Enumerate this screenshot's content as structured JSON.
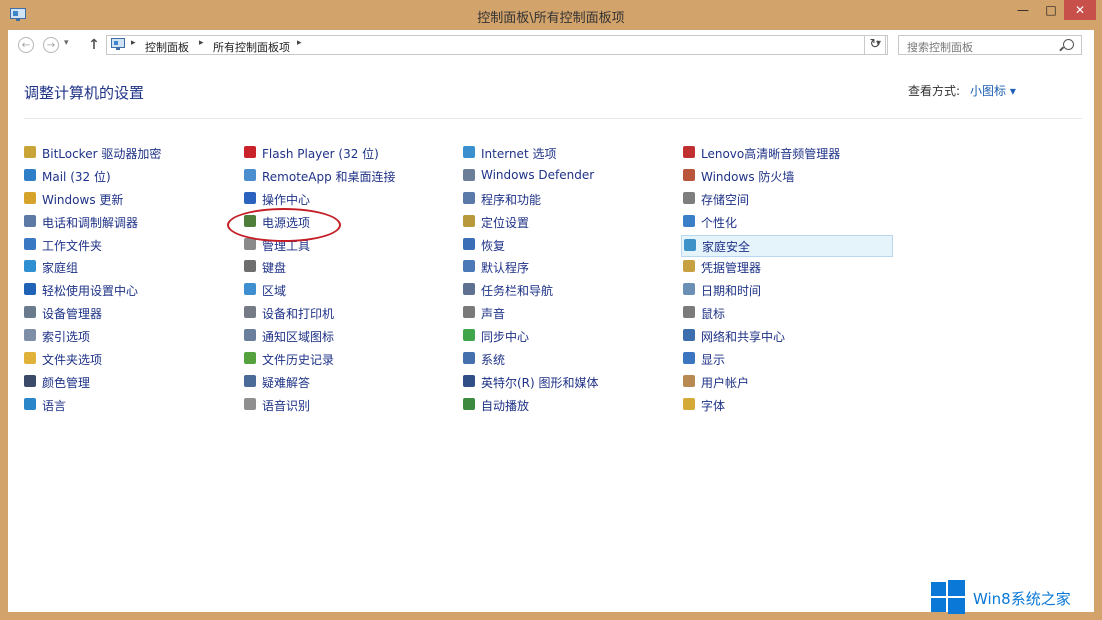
{
  "window": {
    "title": "控制面板\\所有控制面板项",
    "minimize": "—",
    "maximize": "□",
    "close": "✕"
  },
  "toolbar": {
    "back": "←",
    "forward": "→",
    "up": "↑",
    "breadcrumb": [
      "控制面板",
      "所有控制面板项"
    ],
    "refresh": "↻",
    "search_placeholder": "搜索控制面板"
  },
  "header": {
    "page_title": "调整计算机的设置",
    "view_by_label": "查看方式:",
    "view_by_value": "小图标 ▾"
  },
  "columns": [
    [
      {
        "label": "BitLocker 驱动器加密",
        "icon": "bitlocker-icon",
        "color": "#c9a437"
      },
      {
        "label": "Mail (32 位)",
        "icon": "mail-icon",
        "color": "#2e7fc8"
      },
      {
        "label": "Windows 更新",
        "icon": "windows-update-icon",
        "color": "#d6a42a"
      },
      {
        "label": "电话和调制解调器",
        "icon": "phone-modem-icon",
        "color": "#5d7aa6"
      },
      {
        "label": "工作文件夹",
        "icon": "work-folders-icon",
        "color": "#3b78c4"
      },
      {
        "label": "家庭组",
        "icon": "homegroup-icon",
        "color": "#2f8fd3"
      },
      {
        "label": "轻松使用设置中心",
        "icon": "ease-of-access-icon",
        "color": "#2062b6"
      },
      {
        "label": "设备管理器",
        "icon": "device-manager-icon",
        "color": "#6b7b8e"
      },
      {
        "label": "索引选项",
        "icon": "indexing-icon",
        "color": "#7d8ea6"
      },
      {
        "label": "文件夹选项",
        "icon": "folder-options-icon",
        "color": "#e0b23a"
      },
      {
        "label": "颜色管理",
        "icon": "color-management-icon",
        "color": "#3b4a69"
      },
      {
        "label": "语言",
        "icon": "language-icon",
        "color": "#2a86c9"
      }
    ],
    [
      {
        "label": "Flash Player (32 位)",
        "icon": "flash-player-icon",
        "color": "#c9222a"
      },
      {
        "label": "RemoteApp 和桌面连接",
        "icon": "remoteapp-icon",
        "color": "#4a8ed0"
      },
      {
        "label": "操作中心",
        "icon": "action-center-flag-icon",
        "color": "#2b62c0"
      },
      {
        "label": "电源选项",
        "icon": "power-options-icon",
        "color": "#4e7e3a"
      },
      {
        "label": "管理工具",
        "icon": "admin-tools-icon",
        "color": "#8a8a8a"
      },
      {
        "label": "键盘",
        "icon": "keyboard-icon",
        "color": "#6e6e6e"
      },
      {
        "label": "区域",
        "icon": "region-icon",
        "color": "#3f8fd0"
      },
      {
        "label": "设备和打印机",
        "icon": "devices-printers-icon",
        "color": "#747b86"
      },
      {
        "label": "通知区域图标",
        "icon": "notification-icons-icon",
        "color": "#6a7f9b"
      },
      {
        "label": "文件历史记录",
        "icon": "file-history-icon",
        "color": "#54a13e"
      },
      {
        "label": "疑难解答",
        "icon": "troubleshooting-icon",
        "color": "#4a6a97"
      },
      {
        "label": "语音识别",
        "icon": "speech-recognition-icon",
        "color": "#8f8f8f"
      }
    ],
    [
      {
        "label": "Internet 选项",
        "icon": "internet-options-icon",
        "color": "#3a8fcf"
      },
      {
        "label": "Windows Defender",
        "icon": "windows-defender-icon",
        "color": "#6b7f98"
      },
      {
        "label": "程序和功能",
        "icon": "programs-features-icon",
        "color": "#5a78a8"
      },
      {
        "label": "定位设置",
        "icon": "location-settings-icon",
        "color": "#b89a3c"
      },
      {
        "label": "恢复",
        "icon": "recovery-icon",
        "color": "#3a6fb8"
      },
      {
        "label": "默认程序",
        "icon": "default-programs-icon",
        "color": "#4b79b8"
      },
      {
        "label": "任务栏和导航",
        "icon": "taskbar-navigation-icon",
        "color": "#5e7190"
      },
      {
        "label": "声音",
        "icon": "sound-icon",
        "color": "#7a7a7a"
      },
      {
        "label": "同步中心",
        "icon": "sync-center-icon",
        "color": "#3fa64a"
      },
      {
        "label": "系统",
        "icon": "system-icon",
        "color": "#4470ae"
      },
      {
        "label": "英特尔(R) 图形和媒体",
        "icon": "intel-graphics-icon",
        "color": "#2f4f86"
      },
      {
        "label": "自动播放",
        "icon": "autoplay-icon",
        "color": "#3b8a3f"
      }
    ],
    [
      {
        "label": "Lenovo高清晰音频管理器",
        "icon": "lenovo-audio-icon",
        "color": "#c03030"
      },
      {
        "label": "Windows 防火墙",
        "icon": "windows-firewall-icon",
        "color": "#b8553a"
      },
      {
        "label": "存储空间",
        "icon": "storage-spaces-icon",
        "color": "#7e7e7e"
      },
      {
        "label": "个性化",
        "icon": "personalization-icon",
        "color": "#3c7fc9"
      },
      {
        "label": "家庭安全",
        "icon": "family-safety-icon",
        "color": "#3c92c8"
      },
      {
        "label": "凭据管理器",
        "icon": "credential-manager-icon",
        "color": "#c7a042"
      },
      {
        "label": "日期和时间",
        "icon": "date-time-icon",
        "color": "#6c8fb6"
      },
      {
        "label": "鼠标",
        "icon": "mouse-icon",
        "color": "#7b7b7b"
      },
      {
        "label": "网络和共享中心",
        "icon": "network-sharing-icon",
        "color": "#3d6fae"
      },
      {
        "label": "显示",
        "icon": "display-icon",
        "color": "#3b75c0"
      },
      {
        "label": "用户帐户",
        "icon": "user-accounts-icon",
        "color": "#b98954"
      },
      {
        "label": "字体",
        "icon": "fonts-icon",
        "color": "#d4a935"
      }
    ]
  ],
  "selected_item": "家庭安全",
  "watermark": {
    "text": "Win8系统之家",
    "color": "#0a78d7"
  }
}
